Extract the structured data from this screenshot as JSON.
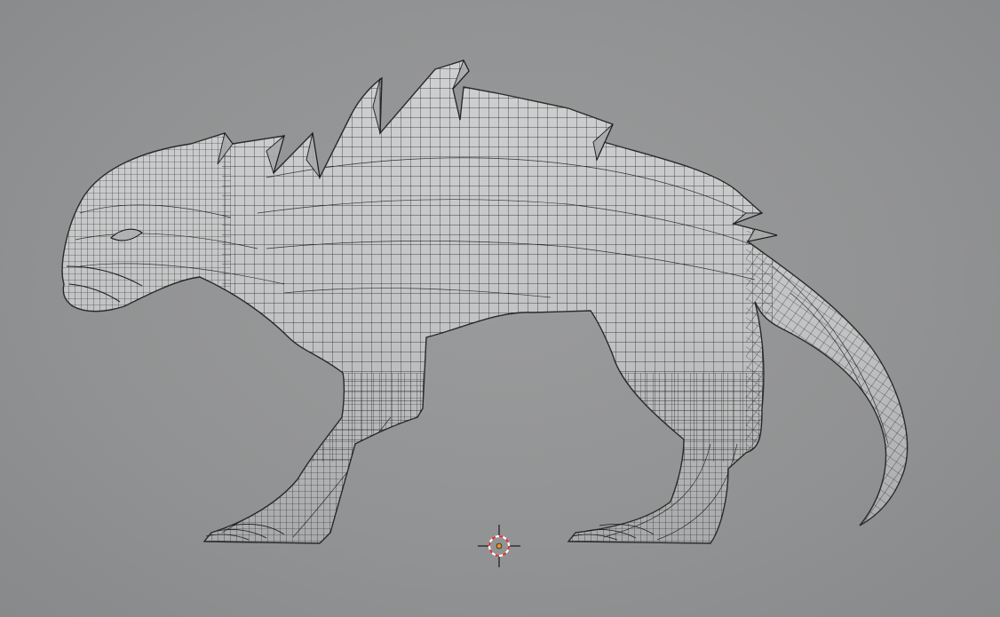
{
  "viewport": {
    "mode": "3d-viewport",
    "background": "#929394"
  },
  "model": {
    "name_icon": "creature-mesh",
    "display": "wireframe-over-solid",
    "shade_color": "#c4c5c6",
    "wire_color": "#1a1a1a"
  },
  "cursor3d": {
    "icon": "3d-cursor-icon",
    "ring_colors": [
      "#d63a3a",
      "#ffffff"
    ],
    "center_color": "#e89a1a"
  }
}
